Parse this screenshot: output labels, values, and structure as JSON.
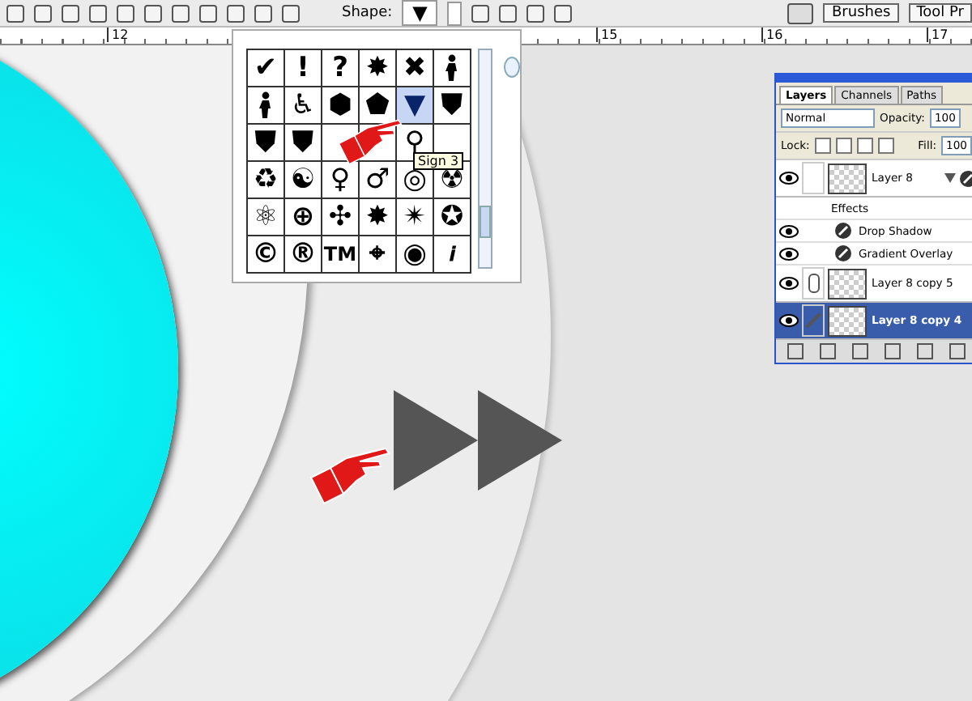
{
  "toolbar": {
    "shape_label": "Shape:",
    "shape_preview": "▼",
    "panel_tabs": [
      "Brushes",
      "Tool Pr"
    ]
  },
  "ruler": {
    "labels": [
      "12",
      "15",
      "16",
      "17"
    ]
  },
  "shape_picker": {
    "tooltip": "Sign 3",
    "cells": [
      {
        "kind": "char",
        "text": "✔",
        "selected": false
      },
      {
        "kind": "char",
        "text": "!",
        "selected": false
      },
      {
        "kind": "char",
        "text": "?",
        "selected": false
      },
      {
        "kind": "char",
        "text": "✸",
        "selected": false
      },
      {
        "kind": "char",
        "text": "✖",
        "selected": false
      },
      {
        "kind": "figure",
        "selected": false
      },
      {
        "kind": "figure",
        "selected": false
      },
      {
        "kind": "char",
        "text": "♿",
        "selected": false
      },
      {
        "kind": "char",
        "text": "⬢",
        "selected": false
      },
      {
        "kind": "char",
        "text": "⬟",
        "selected": false
      },
      {
        "kind": "char",
        "text": "▼",
        "selected": true
      },
      {
        "kind": "char",
        "text": "⛊",
        "selected": false
      },
      {
        "kind": "char",
        "text": "⛊",
        "selected": false
      },
      {
        "kind": "char",
        "text": "⛊",
        "selected": false
      },
      {
        "kind": "blank"
      },
      {
        "kind": "blank"
      },
      {
        "kind": "char",
        "text": "⚲",
        "selected": false
      },
      {
        "kind": "blank"
      },
      {
        "kind": "char",
        "text": "♻",
        "selected": false
      },
      {
        "kind": "char",
        "text": "☯",
        "selected": false
      },
      {
        "kind": "char",
        "text": "♀",
        "selected": false
      },
      {
        "kind": "char",
        "text": "♂",
        "selected": false
      },
      {
        "kind": "char",
        "text": "◎",
        "selected": false
      },
      {
        "kind": "char",
        "text": "☢",
        "selected": false
      },
      {
        "kind": "char",
        "text": "⚛",
        "selected": false
      },
      {
        "kind": "char",
        "text": "⊕",
        "selected": false
      },
      {
        "kind": "char",
        "text": "✣",
        "selected": false
      },
      {
        "kind": "char",
        "text": "✸",
        "selected": false
      },
      {
        "kind": "char",
        "text": "✴",
        "selected": false
      },
      {
        "kind": "char",
        "text": "✪",
        "selected": false
      },
      {
        "kind": "char",
        "text": "©",
        "selected": false
      },
      {
        "kind": "char",
        "text": "®",
        "selected": false
      },
      {
        "kind": "char",
        "text": "TM",
        "selected": false
      },
      {
        "kind": "char",
        "text": "⌖",
        "selected": false
      },
      {
        "kind": "char",
        "text": "◉",
        "selected": false
      },
      {
        "kind": "char",
        "text": "𝒊",
        "selected": false
      }
    ]
  },
  "layers_panel": {
    "tabs": [
      {
        "label": "Layers",
        "selected": true
      },
      {
        "label": "Channels",
        "selected": false
      },
      {
        "label": "Paths",
        "selected": false
      }
    ],
    "blend_mode": "Normal",
    "opacity_label": "Opacity:",
    "opacity": "100",
    "lock_label": "Lock:",
    "fill_label": "Fill:",
    "fill": "100",
    "layers": [
      {
        "name": "Layer 8",
        "visible": true,
        "selected": false,
        "expanded": true,
        "effects_label": "Effects",
        "effects": [
          {
            "name": "Drop Shadow",
            "visible": true
          },
          {
            "name": "Gradient Overlay",
            "visible": true
          }
        ]
      },
      {
        "name": "Layer 8 copy 5",
        "visible": true,
        "selected": false,
        "linked": true
      },
      {
        "name": "Layer 8 copy 4",
        "visible": true,
        "selected": true,
        "linked": false
      }
    ]
  }
}
